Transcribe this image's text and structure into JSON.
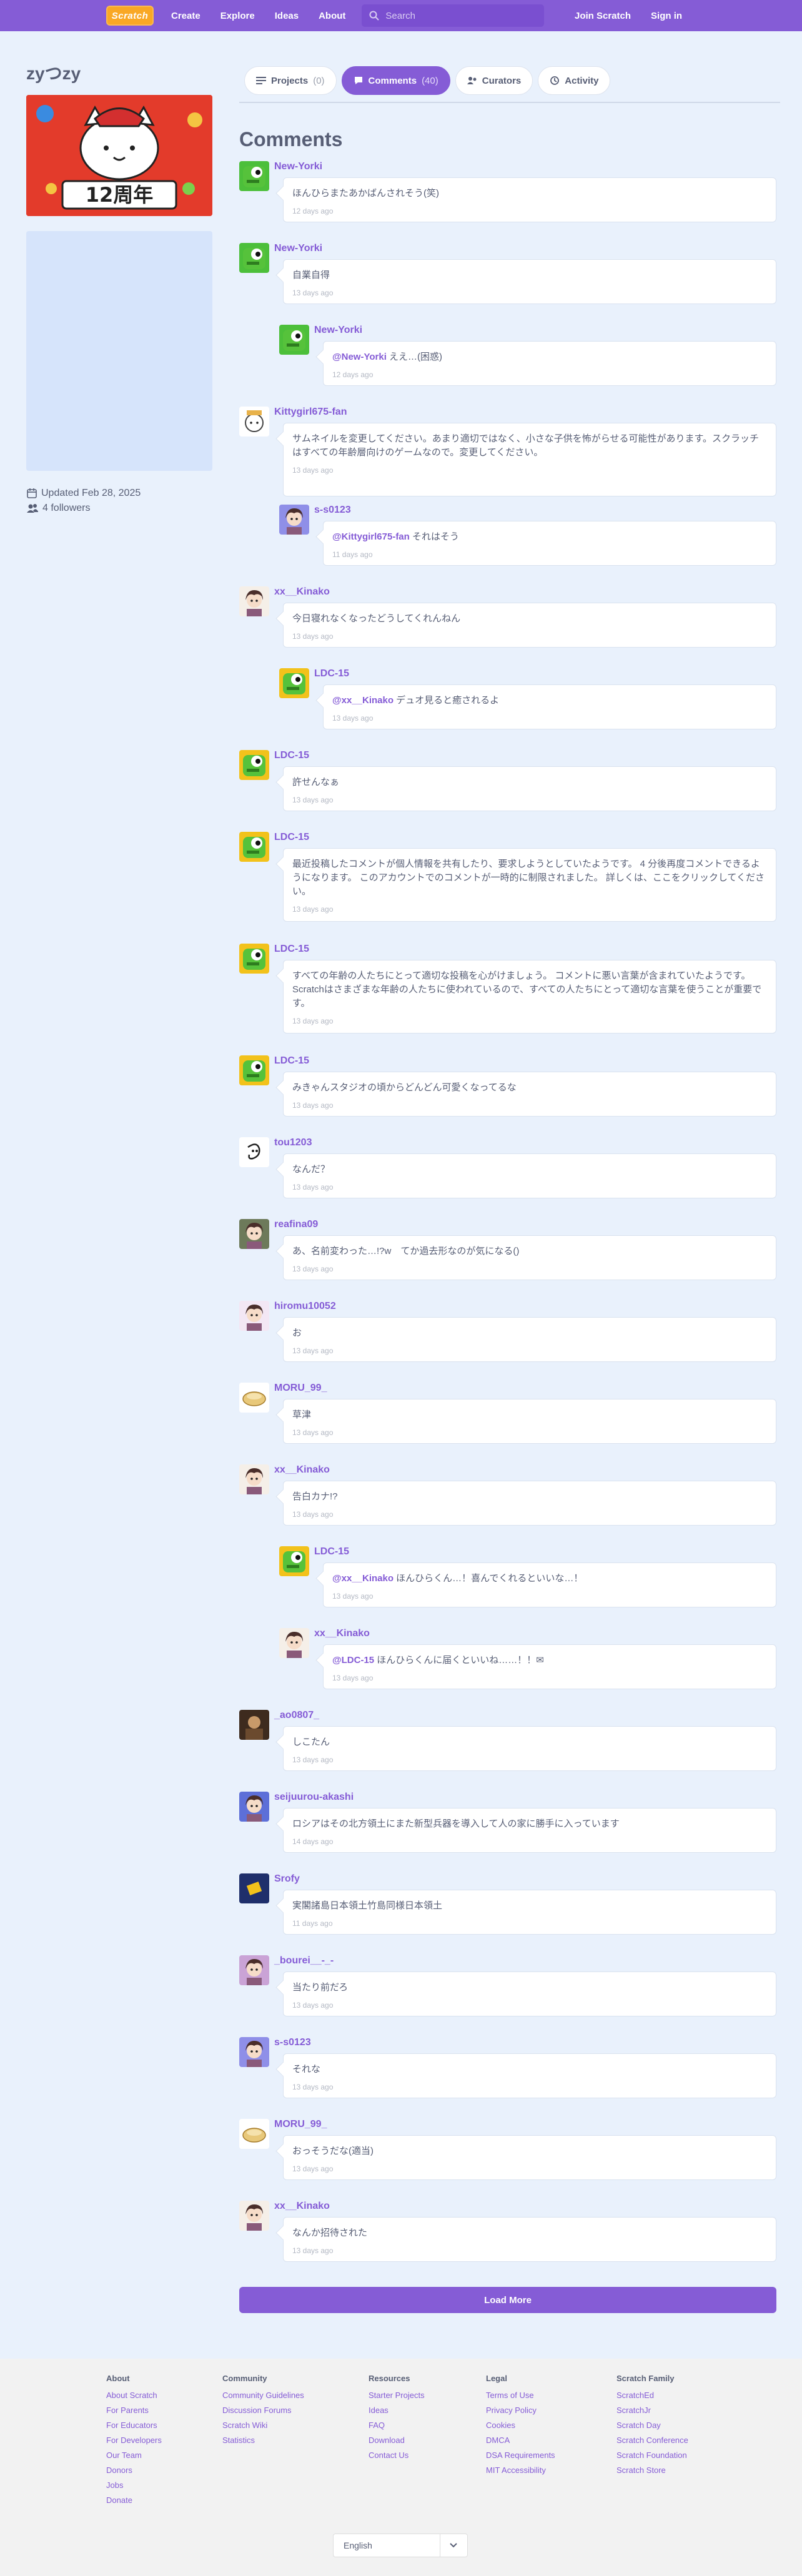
{
  "nav": {
    "logo": "Scratch",
    "links": [
      "Create",
      "Explore",
      "Ideas",
      "About"
    ],
    "search_placeholder": "Search",
    "join": "Join Scratch",
    "signin": "Sign in"
  },
  "profile": {
    "username": "zyつzy",
    "avatar_caption": "12周年",
    "updated": "Updated Feb 28, 2025",
    "followers": "4 followers"
  },
  "tabs": [
    {
      "label": "Projects",
      "count": "(0)"
    },
    {
      "label": "Comments",
      "count": "(40)"
    },
    {
      "label": "Curators",
      "count": ""
    },
    {
      "label": "Activity",
      "count": ""
    }
  ],
  "comments_title": "Comments",
  "comments": [
    {
      "user": "New-Yorki",
      "mention": "",
      "text": "ほんひらまたあかばんされそう(笑)",
      "date": "12 days ago"
    },
    {
      "user": "New-Yorki",
      "mention": "",
      "text": "自業自得",
      "date": "13 days ago"
    },
    {
      "user": "New-Yorki",
      "mention": "@New-Yorki",
      "text": " ええ…(困惑)",
      "date": "12 days ago"
    },
    {
      "user": "Kittygirl675-fan",
      "mention": "",
      "text": "サムネイルを変更してください。あまり適切ではなく、小さな子供を怖がらせる可能性があります。スクラッチはすべての年齢層向けのゲームなので。変更してください。",
      "date": "13 days ago"
    },
    {
      "user": "s-s0123",
      "mention": "@Kittygirl675-fan",
      "text": " それはそう",
      "date": "11 days ago"
    },
    {
      "user": "xx__Kinako",
      "mention": "",
      "text": "今日寝れなくなったどうしてくれんねん",
      "date": "13 days ago"
    },
    {
      "user": "LDC-15",
      "mention": "@xx__Kinako",
      "text": " デュオ見ると癒されるよ",
      "date": "13 days ago"
    },
    {
      "user": "LDC-15",
      "mention": "",
      "text": "許せんなぁ",
      "date": "13 days ago"
    },
    {
      "user": "LDC-15",
      "mention": "",
      "text": "最近投稿したコメントが個人情報を共有したり、要求しようとしていたようです。 4 分後再度コメントできるようになります。 このアカウントでのコメントが一時的に制限されました。 詳しくは、ここをクリックしてください。",
      "date": "13 days ago"
    },
    {
      "user": "LDC-15",
      "mention": "",
      "text": "すべての年齢の人たちにとって適切な投稿を心がけましょう。 コメントに悪い言葉が含まれていたようです。 Scratchはさまざまな年齢の人たちに使われているので、すべての人たちにとって適切な言葉を使うことが重要です。",
      "date": "13 days ago"
    },
    {
      "user": "LDC-15",
      "mention": "",
      "text": "みきゃんスタジオの頃からどんどん可愛くなってるな",
      "date": "13 days ago"
    },
    {
      "user": "tou1203",
      "mention": "",
      "text": "なんだ？",
      "date": "13 days ago"
    },
    {
      "user": "reafina09",
      "mention": "",
      "text": "あ、名前変わった…!?w　てか過去形なのが気になる()",
      "date": "13 days ago"
    },
    {
      "user": "hiromu10052",
      "mention": "",
      "text": "お",
      "date": "13 days ago"
    },
    {
      "user": "MORU_99_",
      "mention": "",
      "text": "草津",
      "date": "13 days ago"
    },
    {
      "user": "xx__Kinako",
      "mention": "",
      "text": "告白カナ!?",
      "date": "13 days ago"
    },
    {
      "user": "LDC-15",
      "mention": "@xx__Kinako",
      "text": " ほんひらくん…！喜んでくれるといいな…！",
      "date": "13 days ago"
    },
    {
      "user": "xx__Kinako",
      "mention": "@LDC-15",
      "text": " ほんひらくんに届くといいね……！！✉",
      "date": "13 days ago"
    },
    {
      "user": "_ao0807_",
      "mention": "",
      "text": "しこたん",
      "date": "13 days ago"
    },
    {
      "user": "seijuurou-akashi",
      "mention": "",
      "text": "ロシアはその北方領土にまた新型兵器を導入して人の家に勝手に入っています",
      "date": "14 days ago"
    },
    {
      "user": "Srofy",
      "mention": "",
      "text": "実閣諸島日本領土竹島同様日本領土",
      "date": "11 days ago"
    },
    {
      "user": "_bourei__-_-",
      "mention": "",
      "text": "当たり前だろ",
      "date": "13 days ago"
    },
    {
      "user": "s-s0123",
      "mention": "",
      "text": "それな",
      "date": "13 days ago"
    },
    {
      "user": "MORU_99_",
      "mention": "",
      "text": "おっそうだな(適当)",
      "date": "13 days ago"
    },
    {
      "user": "xx__Kinako",
      "mention": "",
      "text": "なんか招待された",
      "date": "13 days ago"
    }
  ],
  "load_more": "Load More",
  "footer": {
    "about": {
      "title": "About",
      "links": [
        "About Scratch",
        "For Parents",
        "For Educators",
        "For Developers",
        "Our Team",
        "Donors",
        "Jobs",
        "Donate"
      ]
    },
    "community": {
      "title": "Community",
      "links": [
        "Community Guidelines",
        "Discussion Forums",
        "Scratch Wiki",
        "Statistics"
      ]
    },
    "resources": {
      "title": "Resources",
      "links": [
        "Starter Projects",
        "Ideas",
        "FAQ",
        "Download",
        "Contact Us"
      ]
    },
    "legal": {
      "title": "Legal",
      "links": [
        "Terms of Use",
        "Privacy Policy",
        "Cookies",
        "DMCA",
        "DSA Requirements",
        "MIT Accessibility"
      ]
    },
    "family": {
      "title": "Scratch Family",
      "links": [
        "ScratchEd",
        "ScratchJr",
        "Scratch Day",
        "Scratch Conference",
        "Scratch Foundation",
        "Scratch Store"
      ]
    },
    "language": "English"
  },
  "colors": {
    "brand": "#855cd6",
    "background": "#e9f1fc",
    "text": "#575e75"
  }
}
